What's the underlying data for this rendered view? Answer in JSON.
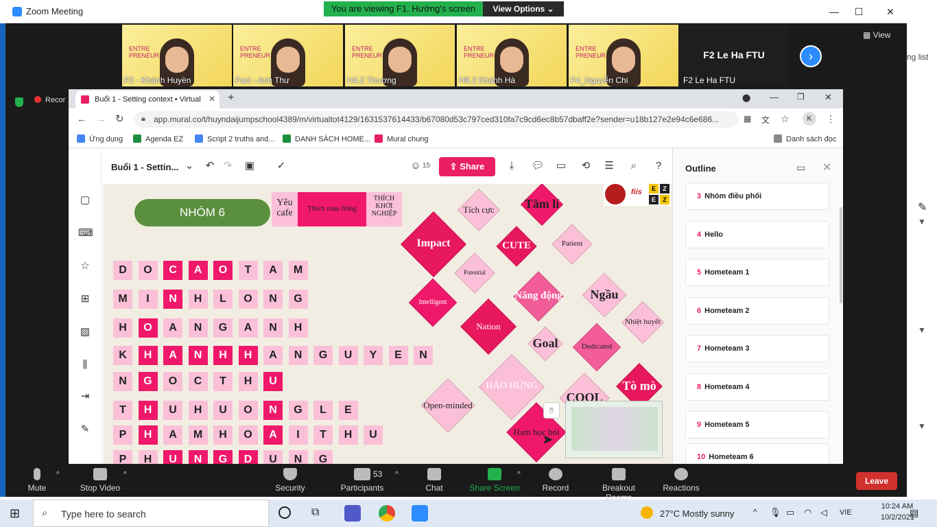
{
  "zoom": {
    "title": "Zoom Meeting",
    "viewing_banner": "You are viewing F1. Hường's screen",
    "view_options": "View Options ⌄",
    "view_label": "View",
    "participants_peek": "ng list",
    "record_badge": "Recor",
    "tiles": [
      {
        "name": "F2 - Khánh Huyền"
      },
      {
        "name": "Faci - Anh Thư"
      },
      {
        "name": "H4.2 Thương"
      },
      {
        "name": "H6.2 Khánh Hà"
      },
      {
        "name": "F4_Nguyễn Chi"
      }
    ],
    "dark_tile": {
      "title": "F2 Le Ha FTU",
      "label": "F2 Le Ha FTU"
    },
    "toolbar": {
      "mute": "Mute",
      "stop_video": "Stop Video",
      "security": "Security",
      "participants": "Participants",
      "participants_count": "53",
      "chat": "Chat",
      "share_screen": "Share Screen",
      "record": "Record",
      "breakout": "Breakout Rooms",
      "reactions": "Reactions",
      "leave": "Leave"
    }
  },
  "chrome": {
    "tab_title": "Buổi 1 - Setting context • Virtual",
    "url": "app.mural.co/t/huyndaijumpschool4389/m/virtualtot4129/1631537614433/b67080d53c797ced310fa7c9cd6ec8b57dbaff2e?sender=u18b127e2e94c6e686...",
    "profile_initial": "K",
    "bookmarks": [
      "Ứng dụng",
      "Agenda EZ",
      "Script 2 truths and...",
      "DANH SÁCH HOME...",
      "Mural chung"
    ],
    "reading_list": "Danh sách đọc"
  },
  "mural": {
    "board_title": "Buổi 1 - Settin...",
    "member_count": "15",
    "share": "Share",
    "outline_title": "Outline",
    "outline_items": [
      {
        "num": "3",
        "label": "Nhóm điều phối"
      },
      {
        "num": "4",
        "label": "Hello"
      },
      {
        "num": "5",
        "label": "Hometeam 1"
      },
      {
        "num": "6",
        "label": "Hometeam 2"
      },
      {
        "num": "7",
        "label": "Hometeam 3"
      },
      {
        "num": "8",
        "label": "Hometeam 4"
      },
      {
        "num": "9",
        "label": "Hometeam 5"
      },
      {
        "num": "10",
        "label": "Hometeam 6"
      }
    ],
    "group_name": "NHÓM 6",
    "notes": [
      "Yêu cafe",
      "Thích màu hồng",
      "THÍCH KHỞI NGHIỆP"
    ],
    "logo_text": "fiis",
    "logo_letters": [
      "E",
      "Z",
      "E",
      "Z"
    ],
    "rows": [
      {
        "letters": [
          "D",
          "O",
          "C",
          "A",
          "O",
          "T",
          "A",
          "M"
        ],
        "dark": [
          2,
          3,
          4
        ]
      },
      {
        "letters": [
          "M",
          "I",
          "N",
          "H",
          "L",
          "O",
          "N",
          "G"
        ],
        "dark": [
          2
        ]
      },
      {
        "letters": [
          "H",
          "O",
          "A",
          "N",
          "G",
          "A",
          "N",
          "H"
        ],
        "dark": [
          1
        ]
      },
      {
        "letters": [
          "K",
          "H",
          "A",
          "N",
          "H",
          "H",
          "A",
          "N",
          "G",
          "U",
          "Y",
          "E",
          "N"
        ],
        "dark": [
          1,
          2,
          3,
          4,
          5
        ]
      },
      {
        "letters": [
          "N",
          "G",
          "O",
          "C",
          "T",
          "H",
          "U"
        ],
        "dark": [
          1,
          6
        ]
      },
      {
        "letters": [
          "T",
          "H",
          "U",
          "H",
          "U",
          "O",
          "N",
          "G",
          "L",
          "E"
        ],
        "dark": [
          1,
          6
        ]
      },
      {
        "letters": [
          "P",
          "H",
          "A",
          "M",
          "H",
          "O",
          "A",
          "I",
          "T",
          "H",
          "U"
        ],
        "dark": [
          1,
          6
        ]
      },
      {
        "letters": [
          "P",
          "H",
          "U",
          "N",
          "G",
          "D",
          "U",
          "N",
          "G"
        ],
        "dark": [
          2,
          3,
          4,
          5
        ]
      }
    ],
    "diamonds": [
      {
        "label": "Tích cực",
        "color": "#fbc0d8",
        "fg": "#222"
      },
      {
        "label": "Tâm lí",
        "color": "#f0186a",
        "fg": "#222"
      },
      {
        "label": "Impact",
        "color": "#e8185e",
        "fg": "#fff"
      },
      {
        "label": "CUTE",
        "color": "#e8185e",
        "fg": "#fff"
      },
      {
        "label": "Patient",
        "color": "#fbc0d8",
        "fg": "#222"
      },
      {
        "label": "Potential",
        "color": "#fbc0d8",
        "fg": "#222"
      },
      {
        "label": "Intelligent",
        "color": "#f0186a",
        "fg": "#fff"
      },
      {
        "label": "Năng động",
        "color": "#f25c98",
        "fg": "#fff"
      },
      {
        "label": "Ngầu",
        "color": "#fbc0d8",
        "fg": "#222"
      },
      {
        "label": "Nation",
        "color": "#e8185e",
        "fg": "#fff"
      },
      {
        "label": "Nhiệt huyết",
        "color": "#fbc0d8",
        "fg": "#222"
      },
      {
        "label": "Goal",
        "color": "#fbc0d8",
        "fg": "#222"
      },
      {
        "label": "Dedicated",
        "color": "#f25c98",
        "fg": "#222"
      },
      {
        "label": "HÀO HỨNG",
        "color": "#fbc0d8",
        "fg": "#fff"
      },
      {
        "label": "COOL",
        "color": "#fbc0d8",
        "fg": "#222"
      },
      {
        "label": "Tò mò",
        "color": "#e8185e",
        "fg": "#fff"
      },
      {
        "label": "Open-minded",
        "color": "#fbc0d8",
        "fg": "#222"
      },
      {
        "label": "Ham học hỏi",
        "color": "#f0186a",
        "fg": "#222"
      }
    ]
  },
  "taskbar": {
    "search_placeholder": "Type here to search",
    "weather": "27°C  Mostly sunny",
    "lang": "VIE",
    "time": "10:24 AM",
    "date": "10/2/2021"
  }
}
